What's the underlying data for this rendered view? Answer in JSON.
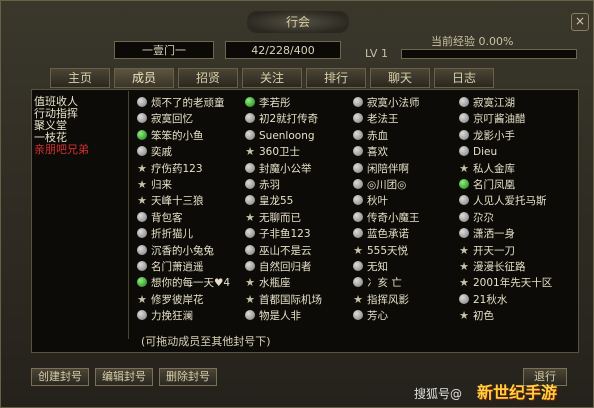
{
  "window": {
    "title": "行会",
    "close_label": "×"
  },
  "header": {
    "guild_name": "一壹门一",
    "members_count": "42/228/400",
    "lv_label": "LV 1",
    "exp_label": "当前经验 0.00%"
  },
  "tabs": [
    "主页",
    "成员",
    "招贤",
    "关注",
    "排行",
    "聊天",
    "日志"
  ],
  "active_tab": 1,
  "sidebar": [
    "值班收人",
    "行动指挥",
    "聚义堂",
    "一枝花",
    "亲朋吧兄弟"
  ],
  "columns": [
    [
      {
        "name": "烦不了的老顽童",
        "icon": "offline"
      },
      {
        "name": "寂寞回忆",
        "icon": "offline"
      },
      {
        "name": "笨笨的小鱼",
        "icon": "online"
      },
      {
        "name": "奕戚",
        "icon": "offline"
      },
      {
        "name": "疗伤药123",
        "icon": "star"
      },
      {
        "name": "归来",
        "icon": "star"
      },
      {
        "name": "天峰十三狼",
        "icon": "star"
      },
      {
        "name": "背包客",
        "icon": "offline"
      },
      {
        "name": "折折猫儿",
        "icon": "offline"
      },
      {
        "name": "沉香的小兔兔",
        "icon": "offline"
      },
      {
        "name": "名门萧逍遥",
        "icon": "offline"
      },
      {
        "name": "想你的每一天♥4",
        "icon": "online"
      },
      {
        "name": "修罗彼岸花",
        "icon": "star"
      },
      {
        "name": "力挽狂澜",
        "icon": "offline"
      }
    ],
    [
      {
        "name": "李若彤",
        "icon": "online"
      },
      {
        "name": "初2就打传奇",
        "icon": "offline"
      },
      {
        "name": "Suenloong",
        "icon": "offline"
      },
      {
        "name": "360卫士",
        "icon": "star"
      },
      {
        "name": "封魔小公举",
        "icon": "offline"
      },
      {
        "name": "赤羽",
        "icon": "offline"
      },
      {
        "name": "皇龙55",
        "icon": "offline"
      },
      {
        "name": "无聊而已",
        "icon": "star"
      },
      {
        "name": "子非鱼123",
        "icon": "offline"
      },
      {
        "name": "巫山不是云",
        "icon": "offline"
      },
      {
        "name": "自然回归者",
        "icon": "offline"
      },
      {
        "name": "水瓶座",
        "icon": "star"
      },
      {
        "name": "首都国际机场",
        "icon": "star"
      },
      {
        "name": "物是人非",
        "icon": "offline"
      }
    ],
    [
      {
        "name": "寂寞小法师",
        "icon": "offline"
      },
      {
        "name": "老法王",
        "icon": "offline"
      },
      {
        "name": "赤血",
        "icon": "offline"
      },
      {
        "name": "喜欢",
        "icon": "offline"
      },
      {
        "name": "闲陪伴啊",
        "icon": "offline"
      },
      {
        "name": "◎川团◎",
        "icon": "offline"
      },
      {
        "name": "秋叶",
        "icon": "offline"
      },
      {
        "name": "传奇小魔王",
        "icon": "offline"
      },
      {
        "name": "蓝色承诺",
        "icon": "offline"
      },
      {
        "name": "555天悦",
        "icon": "star"
      },
      {
        "name": "无知",
        "icon": "offline"
      },
      {
        "name": "冫亥 亡",
        "icon": "offline"
      },
      {
        "name": "指挥风影",
        "icon": "star"
      },
      {
        "name": "芳心",
        "icon": "offline"
      }
    ],
    [
      {
        "name": "寂寞江湖",
        "icon": "offline"
      },
      {
        "name": "京叮酱油醋",
        "icon": "offline"
      },
      {
        "name": "龙影小手",
        "icon": "offline"
      },
      {
        "name": "Dieu",
        "icon": "offline"
      },
      {
        "name": "私人金库",
        "icon": "star"
      },
      {
        "name": "名门凤凰",
        "icon": "online"
      },
      {
        "name": "人见人爱托马斯",
        "icon": "offline"
      },
      {
        "name": "尕尕",
        "icon": "offline"
      },
      {
        "name": "潇洒一身",
        "icon": "offline"
      },
      {
        "name": "开天一刀",
        "icon": "star"
      },
      {
        "name": "漫漫长征路",
        "icon": "star"
      },
      {
        "name": "2001年先天十区",
        "icon": "star"
      },
      {
        "name": "21秋水",
        "icon": "offline"
      },
      {
        "name": "初色",
        "icon": "star"
      }
    ]
  ],
  "hint": "(可拖动成员至其他封号下)",
  "buttons": {
    "create": "创建封号",
    "edit": "编辑封号",
    "delete": "删除封号",
    "right": "退行"
  },
  "watermark": {
    "sohu": "搜狐号@",
    "logo": "新世纪手游"
  }
}
